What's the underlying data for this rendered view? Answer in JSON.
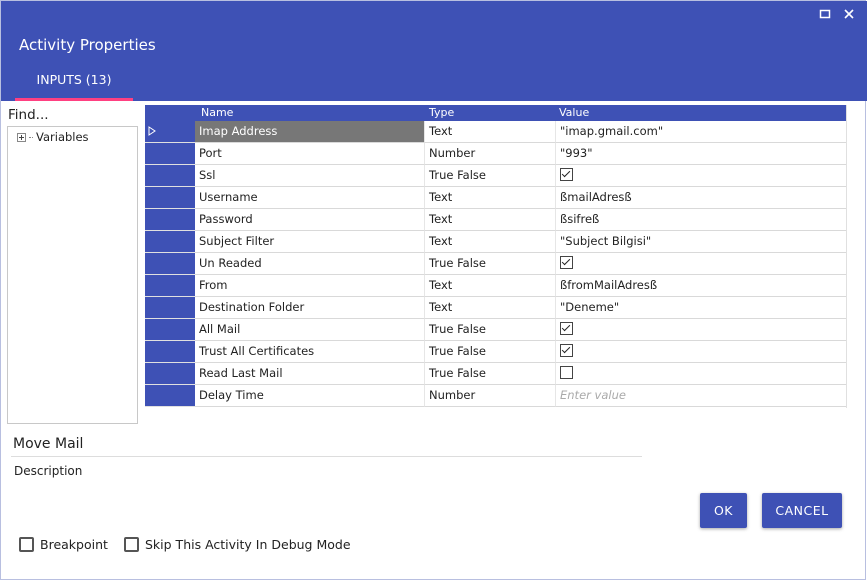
{
  "window": {
    "title": "Activity Properties",
    "controls": {
      "maximize_icon": "maximize-icon",
      "close_icon": "close-icon"
    }
  },
  "tabs": [
    {
      "label": "INPUTS (13)",
      "active": true
    }
  ],
  "colors": {
    "accent": "#3e51b5",
    "tab_indicator": "#ff4081"
  },
  "left_panel": {
    "find_label": "Find...",
    "tree": [
      {
        "label": "Variables",
        "expandable": true
      }
    ]
  },
  "grid": {
    "columns": {
      "name": "Name",
      "type": "Type",
      "value": "Value"
    },
    "rows": [
      {
        "name": "Imap Address",
        "type": "Text",
        "value": "\"imap.gmail.com\"",
        "selected": true
      },
      {
        "name": "Port",
        "type": "Number",
        "value": "\"993\""
      },
      {
        "name": "Ssl",
        "type": "True False",
        "checked": true
      },
      {
        "name": "Username",
        "type": "Text",
        "value": "ßmailAdresß"
      },
      {
        "name": "Password",
        "type": "Text",
        "value": "ßsifreß"
      },
      {
        "name": "Subject Filter",
        "type": "Text",
        "value": "\"Subject Bilgisi\""
      },
      {
        "name": "Un Readed",
        "type": "True False",
        "checked": true
      },
      {
        "name": "From",
        "type": "Text",
        "value": "ßfromMailAdresß"
      },
      {
        "name": "Destination Folder",
        "type": "Text",
        "value": "\"Deneme\""
      },
      {
        "name": "All Mail",
        "type": "True False",
        "checked": true
      },
      {
        "name": "Trust All Certificates",
        "type": "True False",
        "checked": true
      },
      {
        "name": "Read Last Mail",
        "type": "True False",
        "checked": false
      },
      {
        "name": "Delay Time",
        "type": "Number",
        "placeholder": "Enter value"
      }
    ]
  },
  "activity": {
    "name": "Move Mail",
    "description_label": "Description"
  },
  "buttons": {
    "ok": "OK",
    "cancel": "CANCEL"
  },
  "options": {
    "breakpoint": "Breakpoint",
    "skip_debug": "Skip This Activity In Debug Mode"
  }
}
